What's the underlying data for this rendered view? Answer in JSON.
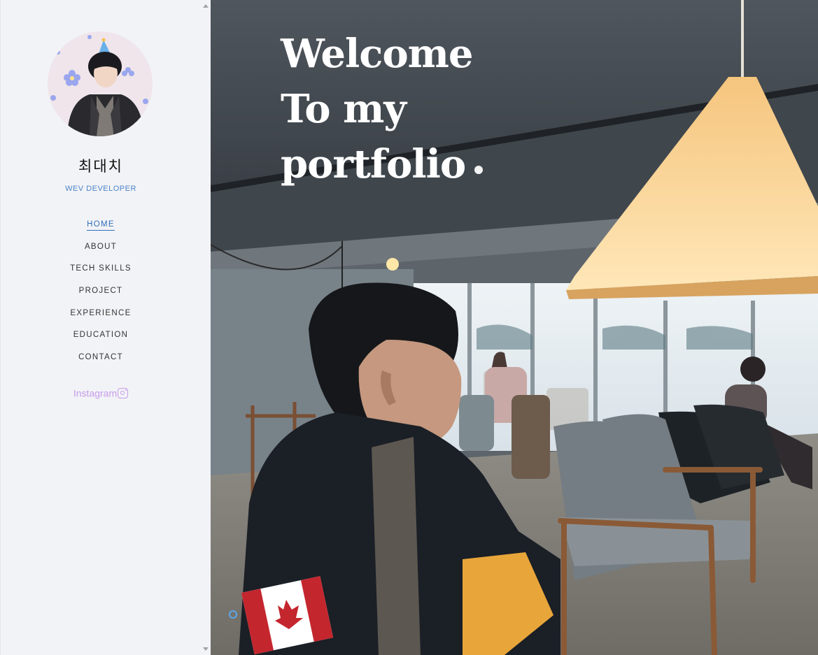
{
  "profile": {
    "name": "최대치",
    "role": "WEV DEVELOPER"
  },
  "nav": {
    "items": [
      {
        "label": "HOME",
        "active": true
      },
      {
        "label": "ABOUT"
      },
      {
        "label": "TECH SKILLS"
      },
      {
        "label": "PROJECT"
      },
      {
        "label": "EXPERIENCE"
      },
      {
        "label": "EDUCATION"
      },
      {
        "label": "CONTACT"
      }
    ]
  },
  "social": {
    "instagram_label": "Instagram",
    "icon": "instagram-icon"
  },
  "hero": {
    "line1": "Welcome",
    "line2": "To my",
    "line3": "portfolio"
  },
  "colors": {
    "sidebar_bg": "#f2f3f7",
    "accent": "#2f6fb8",
    "role_text": "#4c84c9",
    "instagram": "#c79be8"
  }
}
